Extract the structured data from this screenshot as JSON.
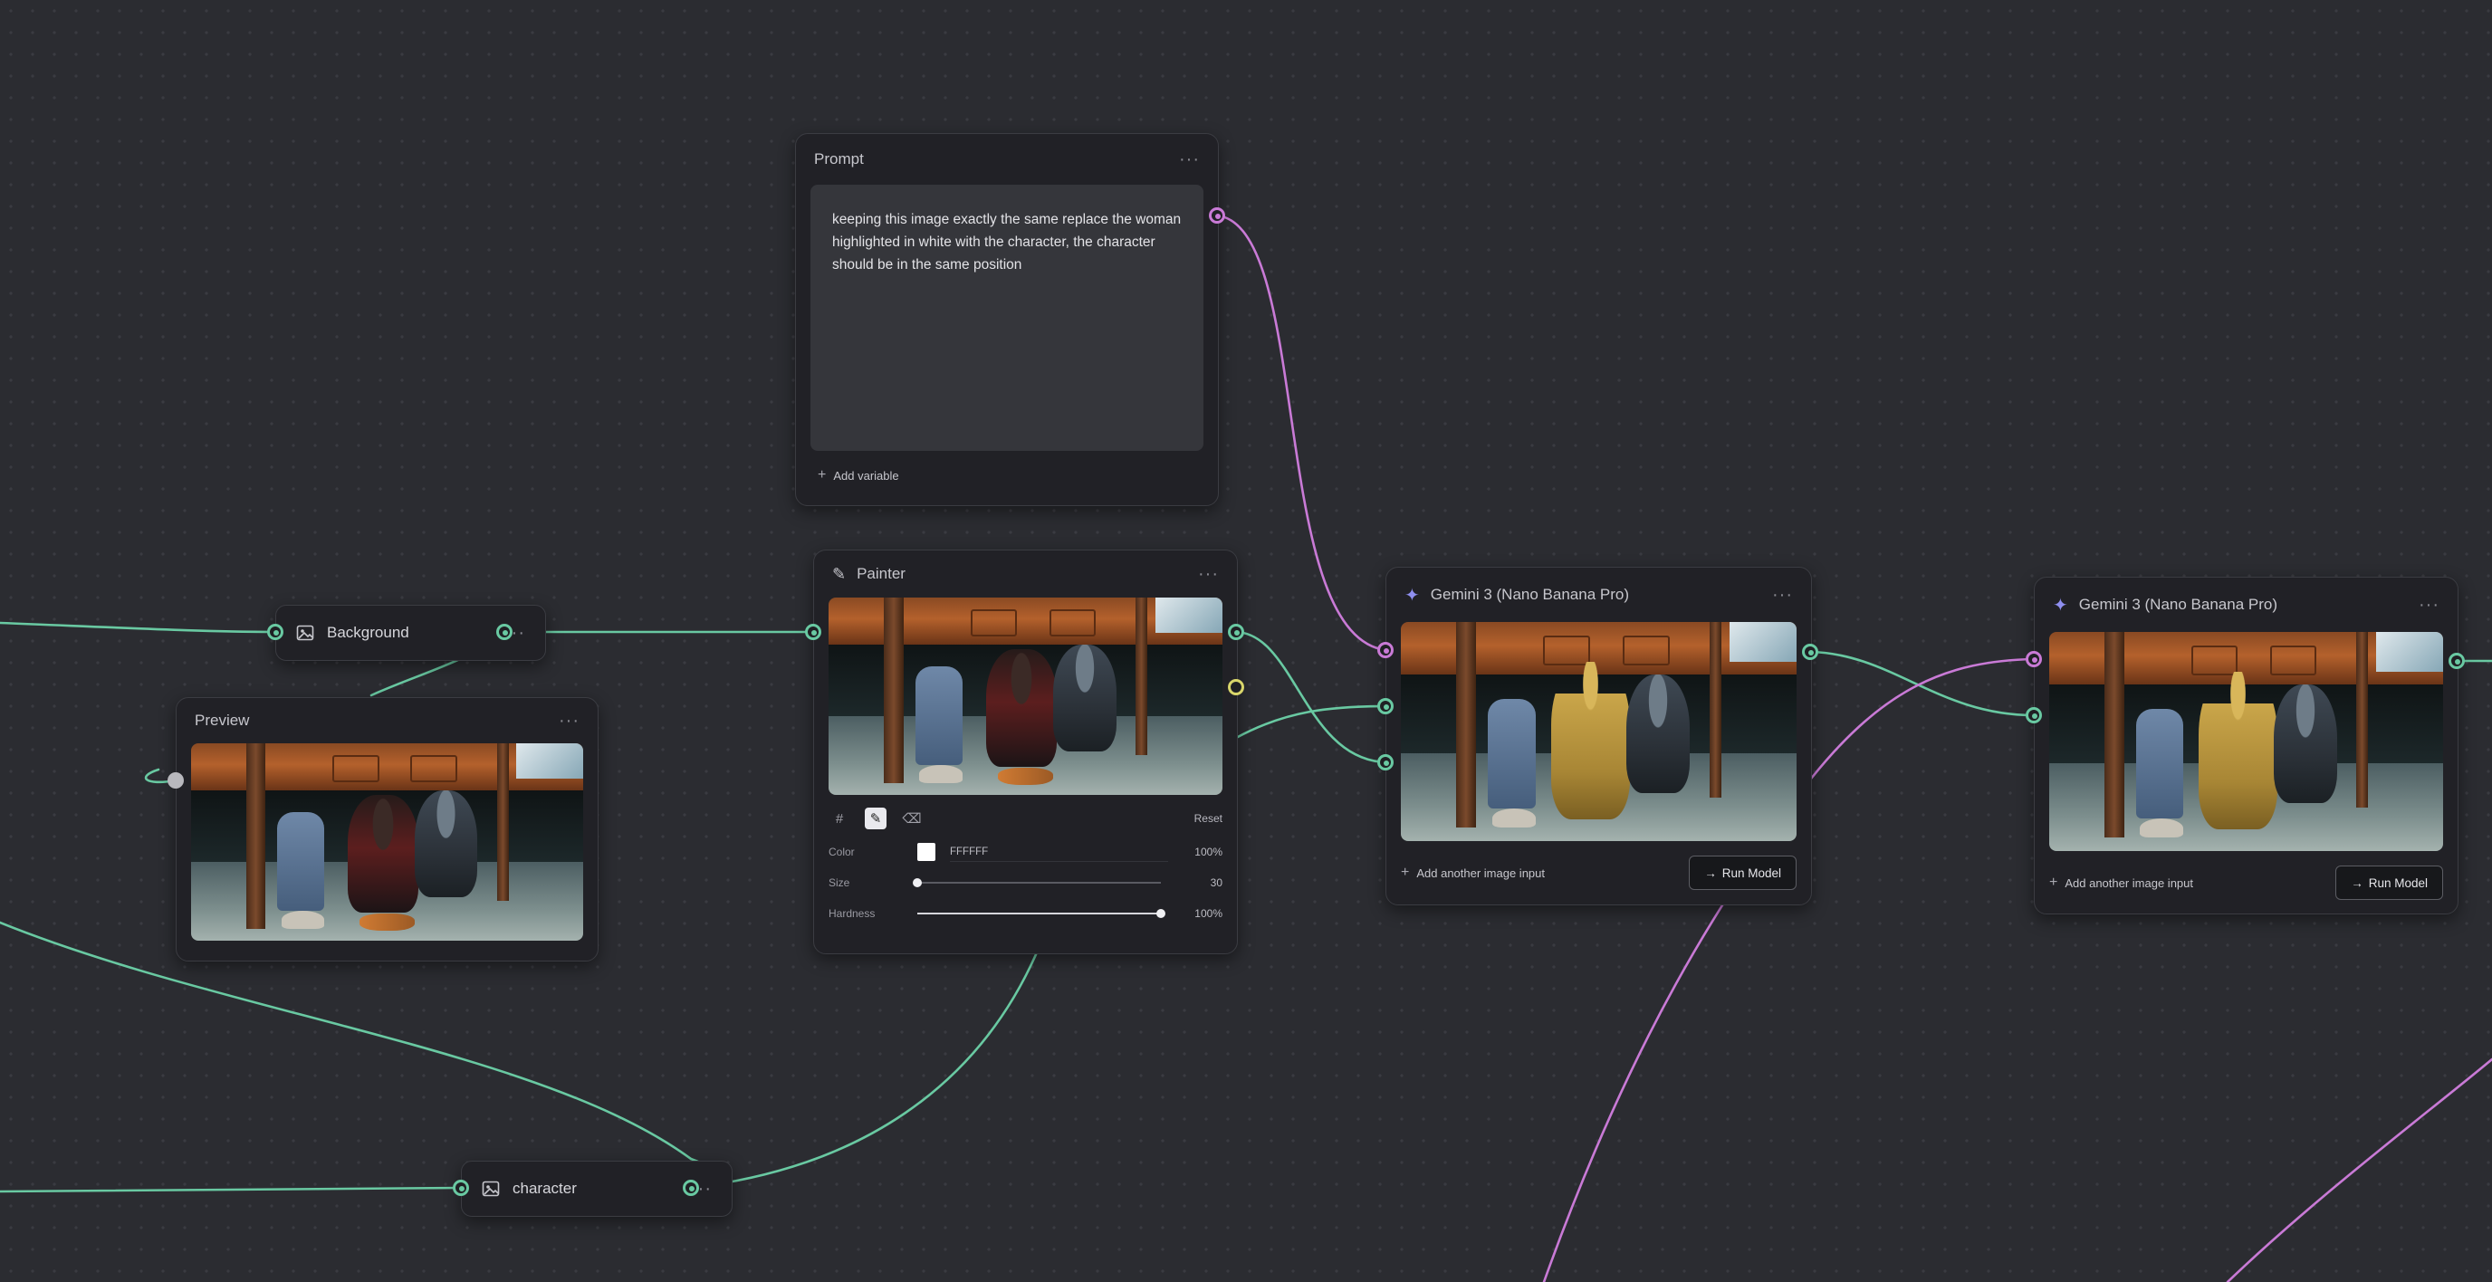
{
  "canvas": {
    "background_color": "#2b2c31",
    "wire_colors": {
      "image": "#69c9a2",
      "text": "#c97ad6",
      "mask": "#d9d66b"
    }
  },
  "nodes": {
    "prompt": {
      "title": "Prompt",
      "text": "keeping this image exactly the same replace the woman highlighted in white with the character, the character should be in the same position",
      "add_variable_label": "Add variable"
    },
    "background": {
      "title": "Background",
      "icon": "image-icon"
    },
    "preview": {
      "title": "Preview"
    },
    "painter": {
      "title": "Painter",
      "reset_label": "Reset",
      "tools": [
        "grid-icon",
        "brush-icon",
        "eraser-icon"
      ],
      "active_tool": "brush-icon",
      "color_label": "Color",
      "color_hex": "FFFFFF",
      "color_opacity": "100%",
      "size_label": "Size",
      "size_value": "30",
      "size_fraction": 0.0,
      "hardness_label": "Hardness",
      "hardness_value": "100%",
      "hardness_fraction": 1.0
    },
    "gemini_1": {
      "title": "Gemini 3 (Nano Banana Pro)",
      "add_input_label": "Add another image input",
      "run_label": "Run Model"
    },
    "gemini_2": {
      "title": "Gemini 3 (Nano Banana Pro)",
      "add_input_label": "Add another image input",
      "run_label": "Run Model"
    },
    "character": {
      "title": "character",
      "icon": "image-icon"
    }
  }
}
